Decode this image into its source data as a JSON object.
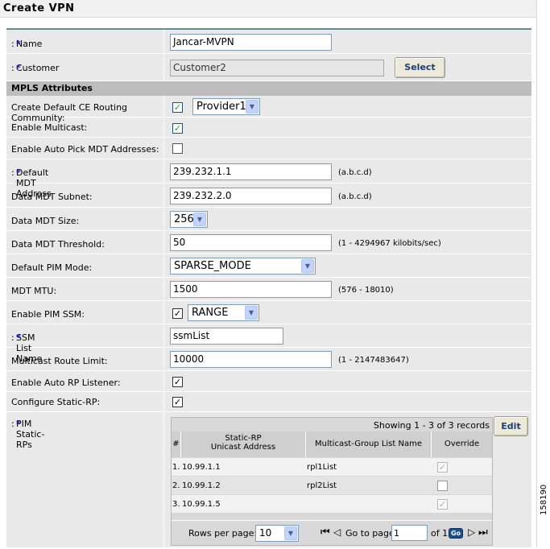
{
  "page": {
    "title": "Create VPN",
    "figure_id": "158190"
  },
  "fields": {
    "name": {
      "label": "Name",
      "value": "Jancar-MVPN"
    },
    "customer": {
      "label": "Customer",
      "value": "Customer2",
      "select_label": "Select"
    }
  },
  "mpls": {
    "section_title": "MPLS Attributes",
    "create_default_ce": {
      "label": "Create Default CE Routing Community:",
      "checked": true,
      "selected": "Provider1"
    },
    "enable_multicast": {
      "label": "Enable Multicast:",
      "checked": true
    },
    "auto_pick_mdt": {
      "label": "Enable Auto Pick MDT Addresses:",
      "checked": false
    },
    "default_mdt_address": {
      "label": "Default MDT Address",
      "value": "239.232.1.1",
      "hint": "(a.b.c.d)"
    },
    "data_mdt_subnet": {
      "label": "Data MDT Subnet:",
      "value": "239.232.2.0",
      "hint": "(a.b.c.d)"
    },
    "data_mdt_size": {
      "label": "Data MDT Size:",
      "selected": "256"
    },
    "data_mdt_threshold": {
      "label": "Data MDT Threshold:",
      "value": "50",
      "hint": "(1 - 4294967 kilobits/sec)"
    },
    "default_pim_mode": {
      "label": "Default PIM Mode:",
      "selected": "SPARSE_MODE"
    },
    "mdt_mtu": {
      "label": "MDT MTU:",
      "value": "1500",
      "hint": "(576 - 18010)"
    },
    "enable_pim_ssm": {
      "label": "Enable PIM SSM:",
      "checked": true,
      "selected": "RANGE"
    },
    "ssm_list_name": {
      "label": "SSM List Name",
      "value": "ssmList"
    },
    "multicast_route_limit": {
      "label": "Multicast Route Limit:",
      "value": "10000",
      "hint": "(1 - 2147483647)"
    },
    "auto_rp_listener": {
      "label": "Enable Auto RP Listener:",
      "checked": true
    },
    "configure_static_rp": {
      "label": "Configure Static-RP:",
      "checked": true
    },
    "pim_static_rps": {
      "label": "PIM Static-RPs"
    }
  },
  "static_rp_table": {
    "showing": "Showing 1 - 3 of 3 records",
    "edit_label": "Edit",
    "headers": {
      "num": "#",
      "address_line1": "Static-RP",
      "address_line2": "Unicast Address",
      "group_list": "Multicast-Group List Name",
      "override": "Override"
    },
    "rows": [
      {
        "num": "1.",
        "address": "10.99.1.1",
        "group_list": "rpl1List",
        "override": true,
        "override_enabled": false
      },
      {
        "num": "2.",
        "address": "10.99.1.2",
        "group_list": "rpl2List",
        "override": false,
        "override_enabled": true
      },
      {
        "num": "3.",
        "address": "10.99.1.5",
        "group_list": "",
        "override": true,
        "override_enabled": false
      }
    ],
    "pager": {
      "rows_per_page_label": "Rows per page:",
      "rows_per_page": "10",
      "go_to_label": "Go to page:",
      "page": "1",
      "of_label": "of 1",
      "go_label": "Go"
    }
  },
  "icons": {
    "check": "✓",
    "dropdown": "▼",
    "first": "⏮",
    "prev": "◁",
    "next": "▷",
    "last": "⏭"
  },
  "colors": {
    "required_star": "#1e1ee6",
    "section_bg": "#bdbdbd",
    "form_bg": "#e9e9e9",
    "check": "#21a121"
  }
}
